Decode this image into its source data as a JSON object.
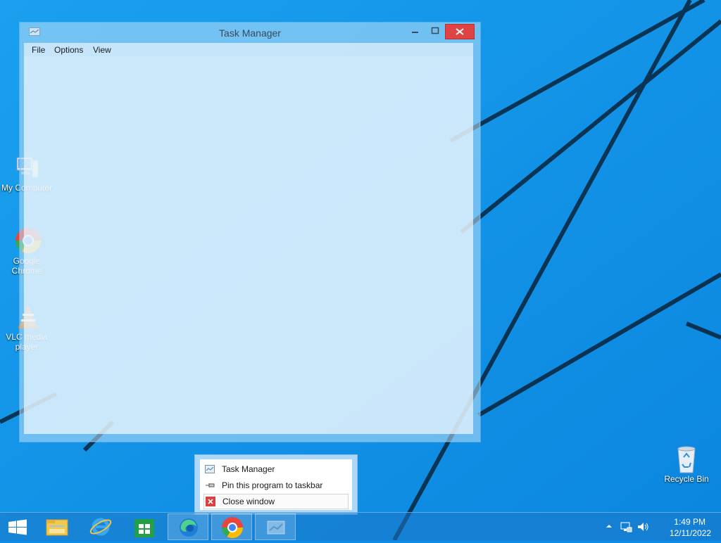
{
  "desktop": {
    "icons": [
      {
        "label": "My Computer"
      },
      {
        "label": "Google Chrome"
      },
      {
        "label": "VLC media player"
      },
      {
        "label": "Recycle Bin"
      }
    ]
  },
  "window": {
    "title": "Task Manager",
    "menus": [
      "File",
      "Options",
      "View"
    ]
  },
  "jump_list": {
    "items": [
      {
        "label": "Task Manager",
        "icon": "task-manager-icon"
      },
      {
        "label": "Pin this program to taskbar",
        "icon": "pin-icon"
      },
      {
        "label": "Close window",
        "icon": "close-icon"
      }
    ]
  },
  "taskbar": {
    "buttons": [
      "start",
      "file-explorer",
      "internet-explorer",
      "store",
      "edge",
      "chrome",
      "task-manager"
    ],
    "clock": {
      "time": "1:49 PM",
      "date": "12/11/2022"
    }
  },
  "colors": {
    "close_red": "#e04343",
    "wallpaper_blue": "#0a8ee6"
  }
}
